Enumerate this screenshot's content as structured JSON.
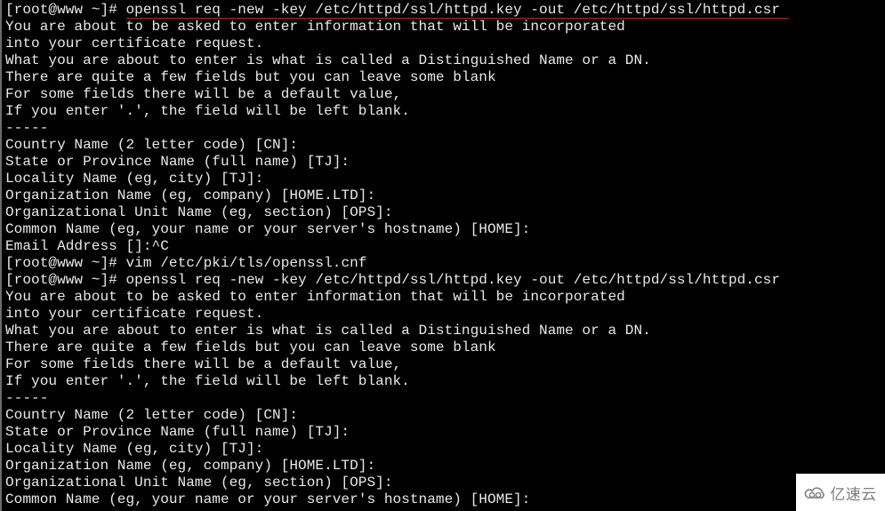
{
  "terminal": {
    "prompt": "[root@www ~]# ",
    "lines": [
      {
        "type": "command",
        "prompt": "[root@www ~]# ",
        "command": "openssl req -new -key /etc/httpd/ssl/httpd.key -out /etc/httpd/ssl/httpd.csr",
        "highlighted": true
      },
      {
        "type": "output",
        "text": "You are about to be asked to enter information that will be incorporated"
      },
      {
        "type": "output",
        "text": "into your certificate request."
      },
      {
        "type": "output",
        "text": "What you are about to enter is what is called a Distinguished Name or a DN."
      },
      {
        "type": "output",
        "text": "There are quite a few fields but you can leave some blank"
      },
      {
        "type": "output",
        "text": "For some fields there will be a default value,"
      },
      {
        "type": "output",
        "text": "If you enter '.', the field will be left blank."
      },
      {
        "type": "output",
        "text": "-----"
      },
      {
        "type": "output",
        "text": "Country Name (2 letter code) [CN]:"
      },
      {
        "type": "output",
        "text": "State or Province Name (full name) [TJ]:"
      },
      {
        "type": "output",
        "text": "Locality Name (eg, city) [TJ]:"
      },
      {
        "type": "output",
        "text": "Organization Name (eg, company) [HOME.LTD]:"
      },
      {
        "type": "output",
        "text": "Organizational Unit Name (eg, section) [OPS]:"
      },
      {
        "type": "output",
        "text": "Common Name (eg, your name or your server's hostname) [HOME]:"
      },
      {
        "type": "output",
        "text": "Email Address []:^C"
      },
      {
        "type": "command",
        "prompt": "[root@www ~]# ",
        "command": "vim /etc/pki/tls/openssl.cnf",
        "highlighted": false
      },
      {
        "type": "command",
        "prompt": "[root@www ~]# ",
        "command": "openssl req -new -key /etc/httpd/ssl/httpd.key -out /etc/httpd/ssl/httpd.csr",
        "highlighted": false
      },
      {
        "type": "output",
        "text": "You are about to be asked to enter information that will be incorporated"
      },
      {
        "type": "output",
        "text": "into your certificate request."
      },
      {
        "type": "output",
        "text": "What you are about to enter is what is called a Distinguished Name or a DN."
      },
      {
        "type": "output",
        "text": "There are quite a few fields but you can leave some blank"
      },
      {
        "type": "output",
        "text": "For some fields there will be a default value,"
      },
      {
        "type": "output",
        "text": "If you enter '.', the field will be left blank."
      },
      {
        "type": "output",
        "text": "-----"
      },
      {
        "type": "output",
        "text": "Country Name (2 letter code) [CN]:"
      },
      {
        "type": "output",
        "text": "State or Province Name (full name) [TJ]:"
      },
      {
        "type": "output",
        "text": "Locality Name (eg, city) [TJ]:"
      },
      {
        "type": "output",
        "text": "Organization Name (eg, company) [HOME.LTD]:"
      },
      {
        "type": "output",
        "text": "Organizational Unit Name (eg, section) [OPS]:"
      },
      {
        "type": "output",
        "text": "Common Name (eg, your name or your server's hostname) [HOME]:"
      }
    ]
  },
  "colors": {
    "background": "#000000",
    "text": "#e8e8e8",
    "highlight_underline": "#c0262a",
    "watermark_text": "#7d7d7d"
  },
  "watermark": {
    "icon": "cloud-logo-icon",
    "text": "亿速云"
  }
}
